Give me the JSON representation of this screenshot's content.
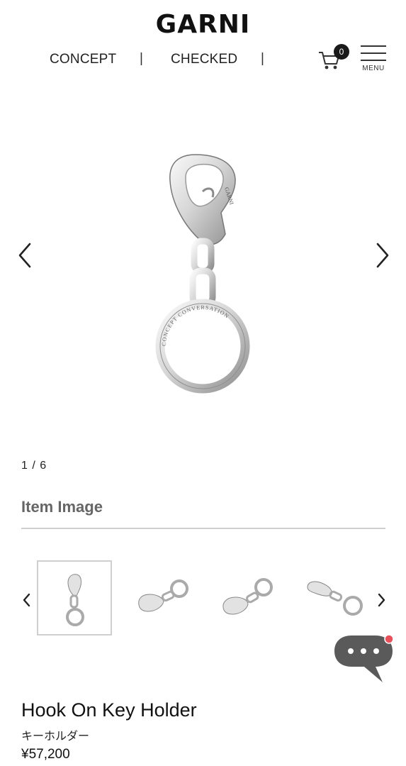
{
  "header": {
    "logo": "GARNI",
    "nav": [
      {
        "label": "CONCEPT"
      },
      {
        "label": "CHECKED"
      }
    ],
    "nav_separator": "|",
    "cart_count": "0",
    "menu_label": "MENU"
  },
  "gallery": {
    "counter": "1 / 6",
    "prev_icon": "chevron-left-icon",
    "next_icon": "chevron-right-icon",
    "engravings": {
      "hook": "GARNI",
      "ring": "CONCEPT CONVERSATION"
    }
  },
  "item_images": {
    "title": "Item Image"
  },
  "product": {
    "name": "Hook On Key Holder",
    "subtitle": "キーホルダー",
    "price": "¥57,200"
  },
  "colors": {
    "chat_bubble": "#5a5a5a",
    "chat_dot": "#e8505b",
    "rule": "#cfcfcf"
  }
}
